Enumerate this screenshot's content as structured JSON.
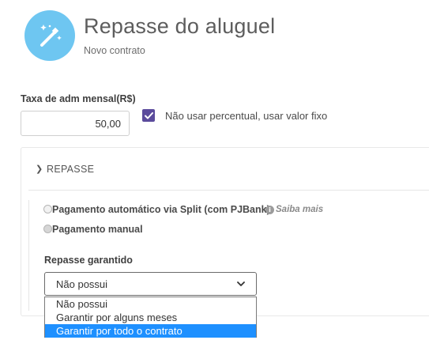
{
  "header": {
    "title": "Repasse do aluguel",
    "subtitle": "Novo contrato",
    "icon": "magic-wand-icon",
    "icon_color": "#6ec6f1"
  },
  "fee": {
    "label": "Taxa de adm mensal(R$)",
    "value": "50,00",
    "fixed_value_checkbox": {
      "checked": true,
      "label": "Não usar percentual, usar valor fixo",
      "color": "#5b4b9c"
    }
  },
  "repasse": {
    "section_title": "REPASSE",
    "payment_options": [
      {
        "label": "Pagamento automático via Split (com PJBank)",
        "selected": false
      },
      {
        "label": "Pagamento manual",
        "selected": true
      }
    ],
    "saiba_mais": "Saiba mais",
    "guarantee": {
      "label": "Repasse garantido",
      "selected_value": "Não possui",
      "options": [
        "Não possui",
        "Garantir por alguns meses",
        "Garantir por todo o contrato"
      ],
      "highlighted_index": 2,
      "highlight_color": "#1e90ff"
    }
  }
}
